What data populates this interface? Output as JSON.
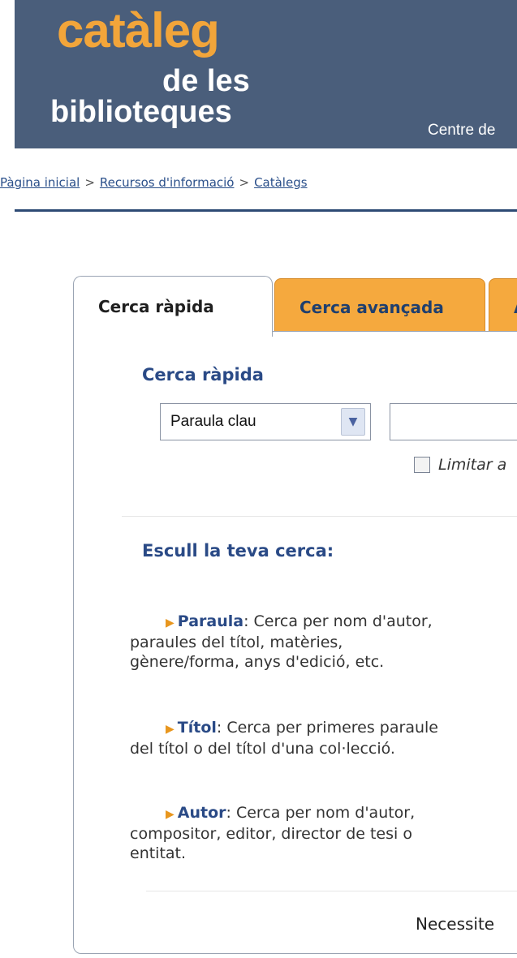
{
  "header": {
    "logo_title": "catàleg",
    "logo_sub1": "de les",
    "logo_sub2": "biblioteques",
    "centre_text": "Centre de"
  },
  "breadcrumb": {
    "items": [
      "Pàgina inicial",
      "Recursos d'informació",
      "Catàlegs"
    ],
    "separator": ">"
  },
  "tabs": [
    {
      "label": "Cerca ràpida",
      "active": true
    },
    {
      "label": "Cerca avançada",
      "active": false
    },
    {
      "label": "A",
      "active": false
    }
  ],
  "quick_search": {
    "title": "Cerca ràpida",
    "select_value": "Paraula clau",
    "input_value": "",
    "limit_label": "Limitar a"
  },
  "choose": {
    "title": "Escull la teva cerca:",
    "options": [
      {
        "term": "Paraula",
        "line1": ": Cerca per nom d'autor,",
        "line2": "paraules del títol, matèries,",
        "line3": "gènere/forma, anys d'edició, etc."
      },
      {
        "term": "Títol",
        "line1": ": Cerca per primeres paraule",
        "line2": "del títol o del títol d'una col·lecció.",
        "line3": ""
      },
      {
        "term": "Autor",
        "line1": ": Cerca per nom d'autor,",
        "line2": "compositor, editor, director de tesi o",
        "line3": "entitat."
      }
    ]
  },
  "footer": {
    "text": "Necessite"
  },
  "colors": {
    "header_bg": "#4a5e7b",
    "logo_orange": "#f2a53a",
    "tab_orange": "#f5a93e",
    "link_blue": "#2a4a86"
  }
}
